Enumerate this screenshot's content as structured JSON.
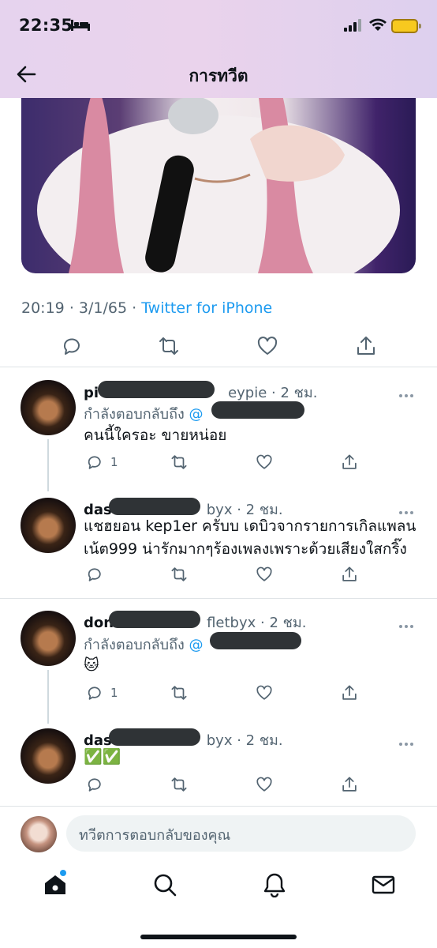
{
  "status_bar": {
    "time": "22:35"
  },
  "header": {
    "title": "การทวีต"
  },
  "tweet": {
    "time": "20:19",
    "date": "3/1/65",
    "source": "Twitter for iPhone",
    "separator": "·"
  },
  "replies": [
    {
      "name_visible_start": "pi",
      "name_visible_end": "eypie",
      "age": "· 2 ชม.",
      "replying_prefix": "กำลังตอบกลับถึง",
      "replying_at": "@",
      "text_lines": [
        "คนนี้ใครอะ ขายหน่อย"
      ],
      "reply_count": "1"
    },
    {
      "name_visible_start": "das",
      "name_visible_end": "byx",
      "age": "· 2 ชม.",
      "text_lines": [
        "แชฮยอน kep1er ครับบ เดบิวจากรายการเกิลแพลน",
        "เน้ต999 น่ารักมากๆร้องเพลงเพราะด้วยเสียงใสกริ๊ง"
      ],
      "reply_count": ""
    },
    {
      "name_visible_start": "don",
      "name_visible_end": "fletbyx",
      "age": "· 2 ชม.",
      "replying_prefix": "กำลังตอบกลับถึง",
      "replying_at": "@",
      "text_lines": [
        "🐱"
      ],
      "reply_count": "1"
    },
    {
      "name_visible_start": "das",
      "name_visible_end": "byx",
      "age": "· 2 ชม.",
      "text_lines": [
        "✅✅"
      ],
      "reply_count": ""
    }
  ],
  "composer": {
    "placeholder": "ทวีตการตอบกลับของคุณ"
  },
  "tab_bar": {
    "items": [
      "home-icon",
      "search-icon",
      "notifications-icon",
      "messages-icon"
    ]
  },
  "colors": {
    "accent": "#1d9bf0",
    "muted": "#536471",
    "header_gradient": "#e6d3ee"
  }
}
